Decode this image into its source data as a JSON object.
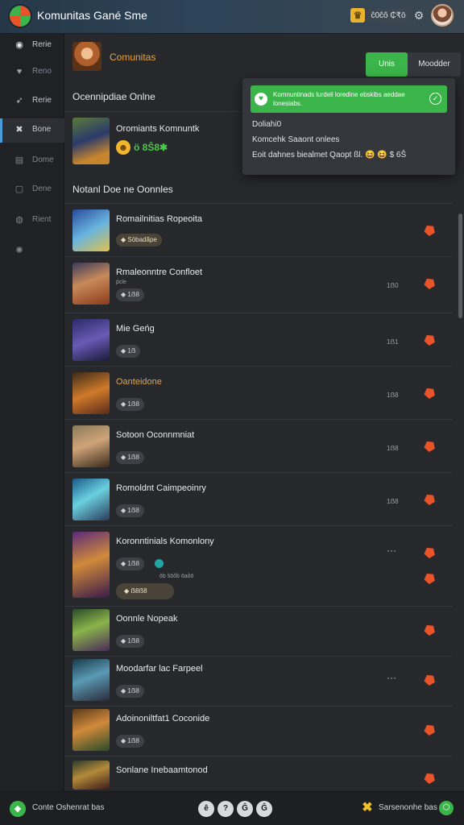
{
  "app": {
    "title": "Komunitas Gané Sme",
    "coins": "ĉ0ĉõ ₵₹ō",
    "logo_icon": "gamepad-logo-icon"
  },
  "topbar": {
    "coin_icon": "crown-icon",
    "settings_icon": "settings-icon"
  },
  "sidebar": {
    "items": [
      {
        "label": "Rerie",
        "icon": "home-icon",
        "glyph": "◉"
      },
      {
        "label": "Reno",
        "icon": "shield-icon",
        "glyph": "♥"
      },
      {
        "label": "Rerie",
        "icon": "feather-icon",
        "glyph": "➶"
      },
      {
        "label": "Bone",
        "icon": "tools-icon",
        "glyph": "✖"
      },
      {
        "label": "Dome",
        "icon": "group-icon",
        "glyph": "▤"
      },
      {
        "label": "Dene",
        "icon": "chat-icon",
        "glyph": "▢"
      },
      {
        "label": "Rient",
        "icon": "globe-icon",
        "glyph": "◍"
      },
      {
        "label": "",
        "icon": "gear-icon",
        "glyph": "✺"
      }
    ]
  },
  "header": {
    "community_title": "Comunitas",
    "primary_button": "Unis",
    "secondary_button": "Moodder"
  },
  "sections": {
    "online": "Ocennipdiae Onlne",
    "list": "Notanl Doe ne Oonnles"
  },
  "featured": {
    "name": "Oromiants Komnuntk",
    "stat": "ö 8Ŝ8✱",
    "smile": "☻"
  },
  "popup": {
    "banner_text": "Komnuntinads lurdeli loredine ebskibs aeddae lonesiabs.",
    "line1": "Doliahi0",
    "line2": "Komcehk Saaont onlees",
    "line3": "Eoit dahnes biealmet Qaopt  ßl.  😆 😆  $ 6Ŝ"
  },
  "rows": [
    {
      "title": "Romailnitias Ropeoita",
      "tag": "◆ Sōbadãpe",
      "count": "",
      "more": "",
      "orange": false
    },
    {
      "title": "Rmaleonntre Confloet",
      "sub": "ṕcle",
      "tag": "◆ 1ẞ8",
      "count": "1ẞ0",
      "more": "",
      "orange": false
    },
    {
      "title": "Mie Geńg",
      "tag": "◆ 1ẞ",
      "count": "1ẞ1",
      "more": "",
      "orange": false
    },
    {
      "title": "Oanteidone",
      "tag": "◆ 1ẞ8",
      "count": "1ẞ8",
      "more": "",
      "orange": true
    },
    {
      "title": "Sotoon Oconnmniat",
      "tag": "◆ 1ẞ8",
      "count": "1ẞ8",
      "more": "",
      "orange": false
    },
    {
      "title": "Romoldnt Caimpeoinry",
      "tag": "◆ 1ẞ8",
      "count": "1ẞ8",
      "more": "",
      "orange": false
    },
    {
      "title": "Koronntinials Komonlony",
      "tag": "◆ 1ẞ8",
      "count": "",
      "more": "···",
      "orange": false,
      "joined": "ōb ŝōôḃ ōaôō",
      "pill": "◆ ẞ8ẞ8"
    },
    {
      "title": "Oonnle Nopeak",
      "tag": "◆ 1ẞ8",
      "count": "",
      "more": "",
      "orange": false
    },
    {
      "title": "Moodarfar lac Farpeel",
      "tag": "◆ 1ẞ8",
      "count": "",
      "more": "···",
      "orange": false
    },
    {
      "title": "Adoinoniltfat1 Coconide",
      "tag": "◆ 1ẞ8",
      "count": "",
      "more": "",
      "orange": false
    },
    {
      "title": "Sonlane Inebaamtonod",
      "tag": "",
      "count": "",
      "more": "",
      "orange": false
    }
  ],
  "bottombar": {
    "text": "Conte Oshenrat bas",
    "dots": [
      "ê",
      "?",
      "Ĝ",
      "Ĝ"
    ],
    "status": "Sarsenonhe bas",
    "logo_glyph": "◆",
    "x_glyph": "✖",
    "end_glyph": "⬡"
  },
  "colors": {
    "accent_green": "#3bb44a",
    "accent_orange": "#e8542a",
    "title_orange": "#e9a33c",
    "background": "#26282c"
  }
}
